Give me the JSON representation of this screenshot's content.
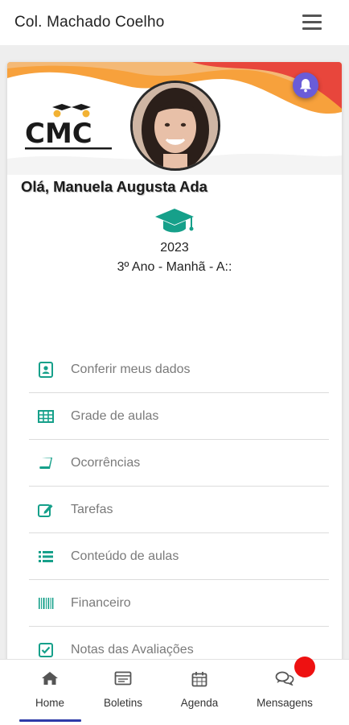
{
  "app": {
    "title": "Col. Machado Coelho"
  },
  "profile": {
    "logo_text": "CMC",
    "greeting": "Olá, Manuela Augusta Ada",
    "year": "2023",
    "class_info": "3º Ano - Manhã - A::"
  },
  "colors": {
    "accent": "#16a08a",
    "nav_active": "#2e3ba8",
    "badge": "#ee1111",
    "bell": "#6a5cd8",
    "wave_orange": "#f7a13c",
    "wave_red": "#e8463c"
  },
  "menu": [
    {
      "label": "Conferir meus dados",
      "icon": "contact-card-icon"
    },
    {
      "label": "Grade de aulas",
      "icon": "table-grid-icon"
    },
    {
      "label": "Ocorrências",
      "icon": "book-icon"
    },
    {
      "label": "Tarefas",
      "icon": "edit-square-icon"
    },
    {
      "label": "Conteúdo de aulas",
      "icon": "list-icon"
    },
    {
      "label": "Financeiro",
      "icon": "barcode-icon"
    },
    {
      "label": "Notas das Avaliações",
      "icon": "check-square-icon"
    }
  ],
  "nav": [
    {
      "label": "Home",
      "icon": "home-icon",
      "active": true
    },
    {
      "label": "Boletins",
      "icon": "report-icon"
    },
    {
      "label": "Agenda",
      "icon": "calendar-icon"
    },
    {
      "label": "Mensagens",
      "icon": "chat-icon"
    }
  ]
}
